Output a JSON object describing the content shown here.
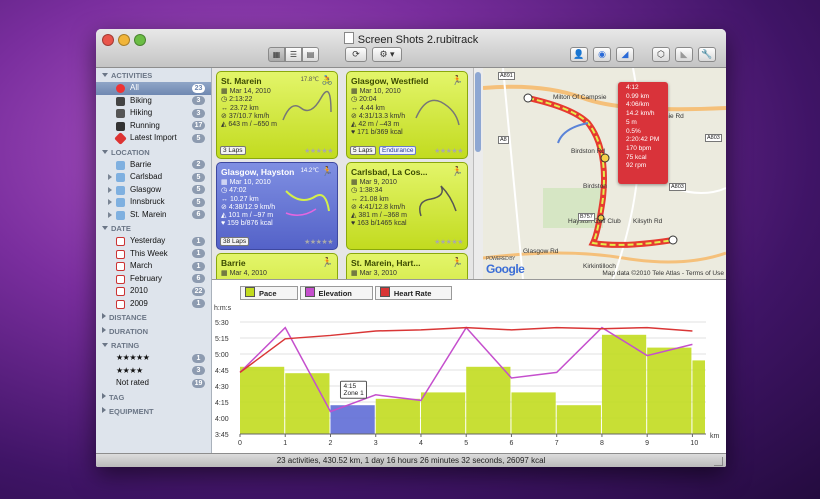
{
  "window": {
    "title": "Screen Shots 2.rubitrack"
  },
  "colors": {
    "pace": "#c2db1f",
    "elevation": "#c54fcd",
    "heart_rate": "#d93636",
    "selected": "#5f6dd6"
  },
  "toolbar": {
    "view_icons": [
      "grid-icon",
      "list-icon",
      "table-icon"
    ],
    "right_icons": [
      "person-icon",
      "globe-icon",
      "chart-icon",
      "box-icon",
      "graph-icon",
      "wrench-icon"
    ],
    "gear_glyph": "⚙ ▾"
  },
  "sidebar": {
    "activities": {
      "header": "ACTIVITIES",
      "items": [
        {
          "label": "All",
          "count": "23"
        },
        {
          "label": "Biking",
          "count": "3"
        },
        {
          "label": "Hiking",
          "count": "3"
        },
        {
          "label": "Running",
          "count": "17"
        },
        {
          "label": "Latest Import",
          "count": "5"
        }
      ]
    },
    "location": {
      "header": "LOCATION",
      "items": [
        {
          "label": "Barrie",
          "count": "2"
        },
        {
          "label": "Carlsbad",
          "count": "5"
        },
        {
          "label": "Glasgow",
          "count": "5"
        },
        {
          "label": "Innsbruck",
          "count": "5"
        },
        {
          "label": "St. Marein",
          "count": "6"
        }
      ]
    },
    "date": {
      "header": "DATE",
      "items": [
        {
          "label": "Yesterday",
          "count": "1"
        },
        {
          "label": "This Week",
          "count": "1"
        },
        {
          "label": "March",
          "count": "1"
        },
        {
          "label": "February",
          "count": "6"
        },
        {
          "label": "2010",
          "count": "22"
        },
        {
          "label": "2009",
          "count": "1"
        }
      ]
    },
    "distance": {
      "header": "DISTANCE"
    },
    "duration": {
      "header": "DURATION"
    },
    "rating": {
      "header": "RATING",
      "items": [
        {
          "stars": "★★★★★",
          "count": "1"
        },
        {
          "stars": "★★★★",
          "count": "3"
        },
        {
          "label": "Not rated",
          "count": "19"
        }
      ]
    },
    "tag": {
      "header": "TAG"
    },
    "equipment": {
      "header": "EQUIPMENT"
    }
  },
  "cards": [
    {
      "title": "St. Marein",
      "weather": "17.8℃",
      "date": "Mar 14, 2010",
      "time": "2:13:22",
      "dist": "23.72 km",
      "speed": "37/10.7 km/h",
      "elev": "643 m / –650 m",
      "kcal": "",
      "laps": "3 Laps",
      "tag": ""
    },
    {
      "title": "Glasgow, Westfield",
      "weather": "",
      "date": "Mar 10, 2010",
      "time": "20:04",
      "dist": "4.44 km",
      "speed": "4:31/13.3 km/h",
      "elev": "42 m / –43 m",
      "kcal": "171 b/369 kcal",
      "laps": "5 Laps",
      "tag": "Endurance"
    },
    {
      "title": "Glasgow, Hayston",
      "weather": "14.2℃",
      "date": "Mar 10, 2010",
      "time": "47:02",
      "dist": "10.27 km",
      "speed": "4:38/12.9 km/h",
      "elev": "101 m / –97 m",
      "kcal": "159 b/876 kcal",
      "laps": "38 Laps",
      "tag": ""
    },
    {
      "title": "Carlsbad, La Cos...",
      "weather": "",
      "date": "Mar 9, 2010",
      "time": "1:38:34",
      "dist": "21.08 km",
      "speed": "4:41/12.8 km/h",
      "elev": "381 m / –368 m",
      "kcal": "163 b/1465 kcal",
      "laps": "",
      "tag": ""
    },
    {
      "title": "Barrie",
      "weather": "",
      "date": "Mar 4, 2010",
      "time": "",
      "dist": "",
      "speed": "",
      "elev": "",
      "kcal": "",
      "laps": "",
      "tag": ""
    },
    {
      "title": "St. Marein, Hart...",
      "weather": "",
      "date": "Mar 3, 2010",
      "time": "",
      "dist": "",
      "speed": "",
      "elev": "",
      "kcal": "",
      "laps": "",
      "tag": ""
    }
  ],
  "map": {
    "popup": [
      "4:12",
      "0.99 km",
      "4:06/km",
      "14.2 km/h",
      "5 m",
      "0.5%",
      "2:20:42 PM",
      "170 bpm",
      "75 kcal",
      "92 rpm"
    ],
    "labels": [
      "Milton Of Campsie",
      "Campsie Rd",
      "Birdston",
      "Hayston Golf Club",
      "Kirkintilloch",
      "Glasgow Rd",
      "Kilsyth Rd",
      "Birdston Rd"
    ],
    "roads": [
      "A891",
      "A803",
      "B757",
      "A803",
      "A8"
    ],
    "logo_prefix": "POWERED BY",
    "logo": "Google",
    "copyright": "Map data ©2010 Tele Atlas - Terms of Use"
  },
  "chart": {
    "tabs": [
      {
        "label": "Pace"
      },
      {
        "label": "Elevation"
      },
      {
        "label": "Heart Rate"
      }
    ],
    "annotation": [
      "4:15",
      "Zone 1"
    ]
  },
  "chart_data": {
    "type": "area",
    "ylabel": "h:m:s",
    "xlabel": "km",
    "y_ticks": [
      "5:30",
      "5:15",
      "5:00",
      "4:45",
      "4:30",
      "4:15",
      "4:00",
      "3:45"
    ],
    "x_ticks": [
      "0",
      "1",
      "2",
      "3",
      "4",
      "5",
      "6",
      "7",
      "8",
      "9",
      "10"
    ],
    "xlim": [
      0,
      10.3
    ],
    "series": [
      {
        "name": "Pace",
        "x": [
          0,
          1,
          2,
          3,
          4,
          5,
          6,
          7,
          8,
          9,
          10
        ],
        "values": [
          4.8,
          4.7,
          4.2,
          4.3,
          4.4,
          4.8,
          4.4,
          4.2,
          5.3,
          5.1,
          4.9
        ]
      },
      {
        "name": "Elevation",
        "x": [
          0,
          1,
          2,
          3,
          4,
          5,
          6,
          7,
          8,
          9,
          10
        ],
        "values": [
          0.55,
          0.95,
          0.2,
          0.35,
          0.3,
          0.95,
          0.5,
          0.55,
          0.95,
          0.7,
          0.8
        ]
      },
      {
        "name": "Heart Rate",
        "x": [
          0,
          1,
          2,
          3,
          4,
          5,
          6,
          7,
          8,
          9,
          10
        ],
        "values": [
          0.55,
          0.85,
          0.88,
          0.92,
          0.93,
          0.95,
          0.93,
          0.95,
          0.94,
          0.95,
          0.92
        ]
      }
    ]
  },
  "status": "23 activities, 430.52 km, 1 day 16 hours 26 minutes 32 seconds, 26097 kcal"
}
